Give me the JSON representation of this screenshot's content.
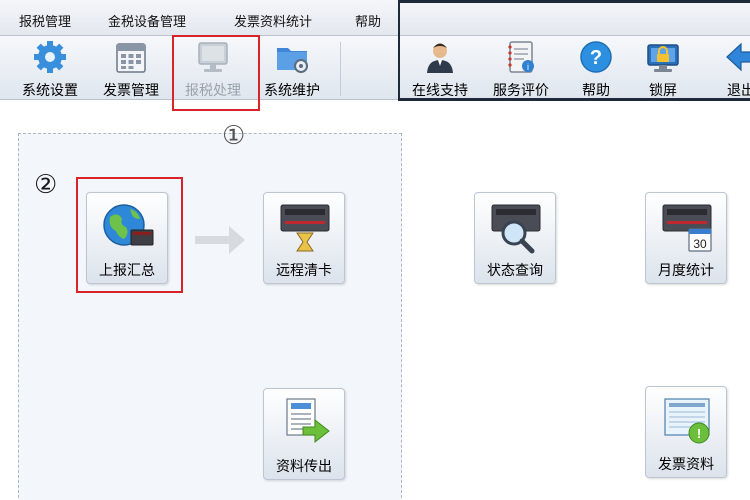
{
  "menu": {
    "items": [
      "报税管理",
      "金税设备管理",
      "发票资料统计",
      "帮助"
    ]
  },
  "toolbar": {
    "buttons": [
      {
        "label": "系统设置",
        "icon": "gear-icon"
      },
      {
        "label": "发票管理",
        "icon": "calendar-icon"
      },
      {
        "label": "报税处理",
        "icon": "monitor-icon",
        "disabled": true
      },
      {
        "label": "系统维护",
        "icon": "folder-gear-icon"
      },
      {
        "label": "在线支持",
        "icon": "user-icon"
      },
      {
        "label": "服务评价",
        "icon": "notebook-icon"
      },
      {
        "label": "帮助",
        "icon": "help-icon"
      },
      {
        "label": "锁屏",
        "icon": "lock-screen-icon"
      },
      {
        "label": "退出",
        "icon": "exit-arrow-icon"
      }
    ]
  },
  "annotations": {
    "step1": "①",
    "step2": "②"
  },
  "tiles": {
    "upload_summary": "上报汇总",
    "remote_clear": "远程清卡",
    "status_query": "状态查询",
    "monthly_stats": "月度统计",
    "data_transfer": "资料传出",
    "invoice_data": "发票资料"
  },
  "calendar_day": "30",
  "colors": {
    "highlight": "#d8232a",
    "accent_blue": "#2c7fd2",
    "panel_bg": "#f3f7fc"
  }
}
